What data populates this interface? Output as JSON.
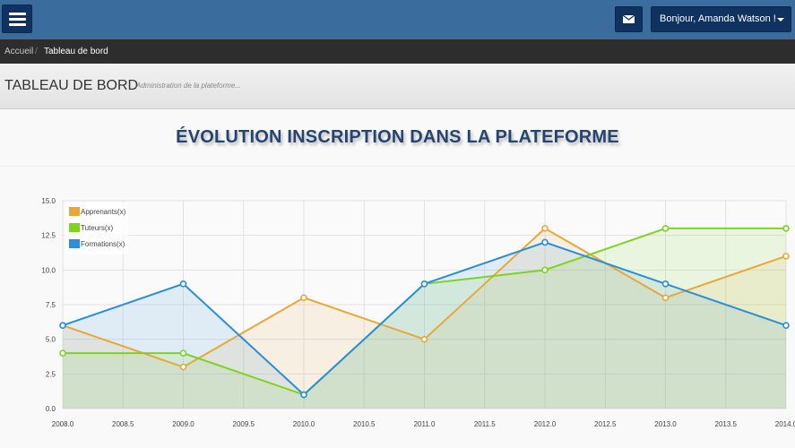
{
  "header": {
    "menu_icon": "hamburger-menu-icon",
    "mail_icon": "envelope-icon",
    "user_greeting": "Bonjour, Amanda Watson !",
    "caret_icon": "caret-down-icon"
  },
  "breadcrumb": {
    "home": "Accueil",
    "separator": "/",
    "current": "Tableau de bord"
  },
  "page": {
    "title": "TABLEAU DE BORD",
    "subtitle": "Administration de la plateforme..."
  },
  "chart_title": "ÉVOLUTION INSCRIPTION DANS LA PLATEFORME",
  "colors": {
    "topbar": "#3b6c9e",
    "button": "#0f3260",
    "breadbar": "#2d2d2d",
    "title": "#25456f"
  },
  "chart_data": {
    "type": "area",
    "title": "ÉVOLUTION INSCRIPTION DANS LA PLATEFORME",
    "xlabel": "",
    "ylabel": "",
    "xlim": [
      2008.0,
      2014.0
    ],
    "ylim": [
      0.0,
      15.0
    ],
    "x_ticks": [
      "2008.0",
      "2008.5",
      "2009.0",
      "2009.5",
      "2010.0",
      "2010.5",
      "2011.0",
      "2011.5",
      "2012.0",
      "2012.5",
      "2013.0",
      "2013.5",
      "2014.0"
    ],
    "y_ticks": [
      "0.0",
      "2.5",
      "5.0",
      "7.5",
      "10.0",
      "12.5",
      "15.0"
    ],
    "grid": true,
    "legend_position": "top-left",
    "x": [
      2008,
      2009,
      2010,
      2011,
      2012,
      2013,
      2014
    ],
    "series": [
      {
        "name": "Apprenants(x)",
        "color": "#e8a838",
        "values": [
          6,
          3,
          8,
          5,
          13,
          8,
          11
        ]
      },
      {
        "name": "Tuteurs(x)",
        "color": "#7ed321",
        "values": [
          4,
          4,
          1,
          9,
          10,
          13,
          13
        ]
      },
      {
        "name": "Formations(x)",
        "color": "#2a8fd8",
        "values": [
          6,
          9,
          1,
          9,
          12,
          9,
          6
        ]
      }
    ]
  }
}
